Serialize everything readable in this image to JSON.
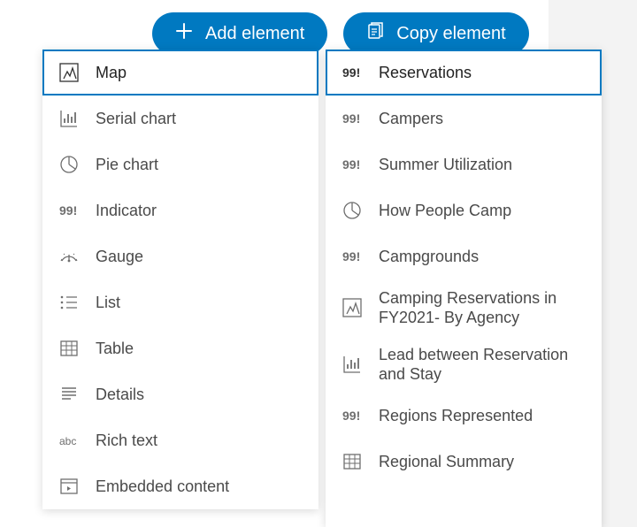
{
  "buttons": {
    "add": "Add element",
    "copy": "Copy element"
  },
  "elements": [
    {
      "icon": "map",
      "label": "Map",
      "selected": true
    },
    {
      "icon": "serial-chart",
      "label": "Serial chart"
    },
    {
      "icon": "pie-chart",
      "label": "Pie chart"
    },
    {
      "icon": "indicator",
      "label": "Indicator"
    },
    {
      "icon": "gauge",
      "label": "Gauge"
    },
    {
      "icon": "list",
      "label": "List"
    },
    {
      "icon": "table",
      "label": "Table"
    },
    {
      "icon": "details",
      "label": "Details"
    },
    {
      "icon": "rich-text",
      "label": "Rich text"
    },
    {
      "icon": "embedded",
      "label": "Embedded content"
    }
  ],
  "instances": [
    {
      "icon": "indicator",
      "label": "Reservations",
      "selected": true
    },
    {
      "icon": "indicator",
      "label": "Campers"
    },
    {
      "icon": "indicator",
      "label": "Summer Utilization"
    },
    {
      "icon": "pie-chart",
      "label": "How People Camp"
    },
    {
      "icon": "indicator",
      "label": "Campgrounds"
    },
    {
      "icon": "map",
      "label": "Camping Reservations in FY2021- By Agency",
      "tall": true
    },
    {
      "icon": "serial-chart",
      "label": "Lead between Reservation and Stay",
      "tall": true
    },
    {
      "icon": "indicator",
      "label": "Regions Represented"
    },
    {
      "icon": "table",
      "label": "Regional Summary"
    }
  ]
}
